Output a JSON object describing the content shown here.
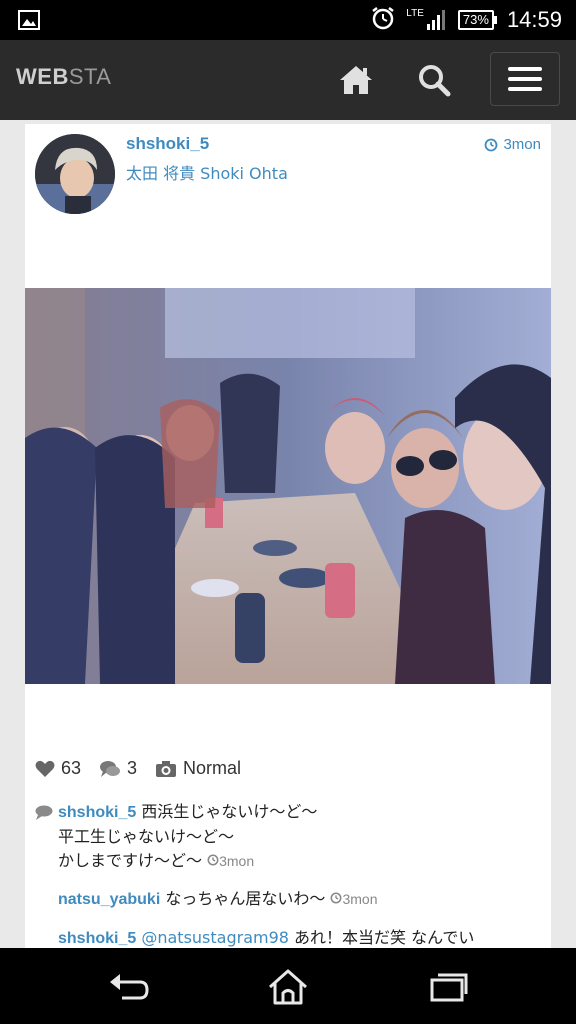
{
  "status_bar": {
    "time": "14:59",
    "battery": "73%",
    "network": "LTE",
    "icons": [
      "image-icon",
      "alarm-icon",
      "signal-icon",
      "battery-icon"
    ]
  },
  "header": {
    "logo_bold": "WEB",
    "logo_rest": "STA",
    "icons": [
      "home-icon",
      "search-icon",
      "menu-icon"
    ]
  },
  "post": {
    "username": "shshoki_5",
    "full_name": "太田 将貴 Shoki Ohta",
    "time": "3mon",
    "likes": "63",
    "comments_count": "3",
    "filter": "Normal"
  },
  "comments": [
    {
      "user": "shshoki_5",
      "lines": [
        "西浜生じゃないけ～ど～",
        "平工生じゃないけ～ど～",
        "かしまですけ～ど～"
      ],
      "time": "3mon"
    },
    {
      "user": "natsu_yabuki",
      "text": "なっちゃん居ないわ～",
      "time": "3mon"
    },
    {
      "user": "shshoki_5",
      "mention": "@natsustagram98",
      "text": "あれ！本当だ笑 なんでい"
    }
  ],
  "nav": {
    "icons": [
      "back-icon",
      "home-icon",
      "recents-icon"
    ]
  },
  "colors": {
    "link": "#3f8bbf",
    "appbar": "#2b2b2b",
    "background": "#e9e9e9"
  }
}
